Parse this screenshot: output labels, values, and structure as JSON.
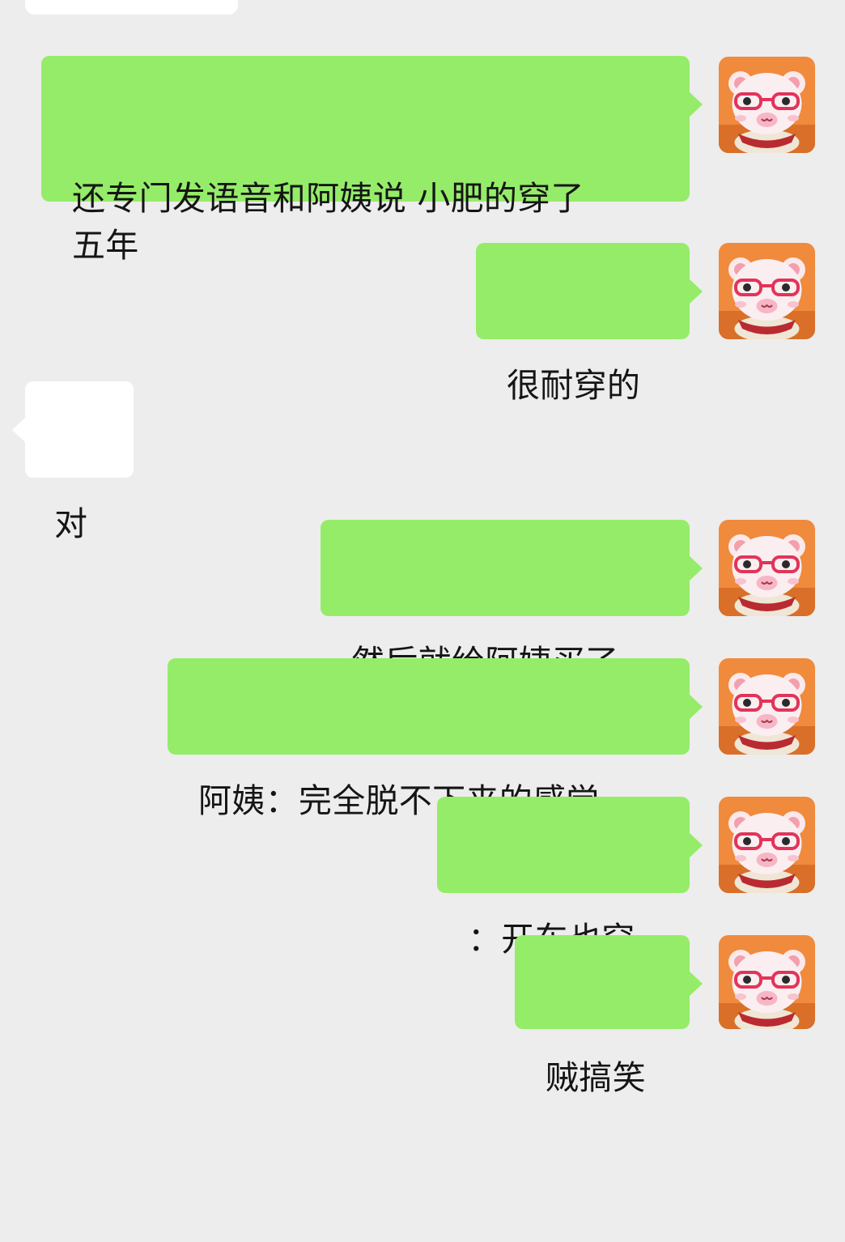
{
  "chat": {
    "messages": [
      {
        "direction": "in",
        "text": ""
      },
      {
        "direction": "out",
        "text": "还专门发语音和阿姨说 小肥的穿了\n五年"
      },
      {
        "direction": "out",
        "text": "很耐穿的"
      },
      {
        "direction": "in",
        "text": "对"
      },
      {
        "direction": "out",
        "text": "然后就给阿姨买了"
      },
      {
        "direction": "out",
        "text": "阿姨：完全脱不下来的感觉"
      },
      {
        "direction": "out",
        "text": "：开车也穿"
      },
      {
        "direction": "out",
        "text": "贼搞笑"
      }
    ],
    "avatar_icon": "bear-with-glasses-avatar-icon",
    "colors": {
      "background": "#ededed",
      "outgoing_bubble": "#95ec69",
      "incoming_bubble": "#ffffff",
      "avatar_background": "#f08a3c"
    }
  }
}
